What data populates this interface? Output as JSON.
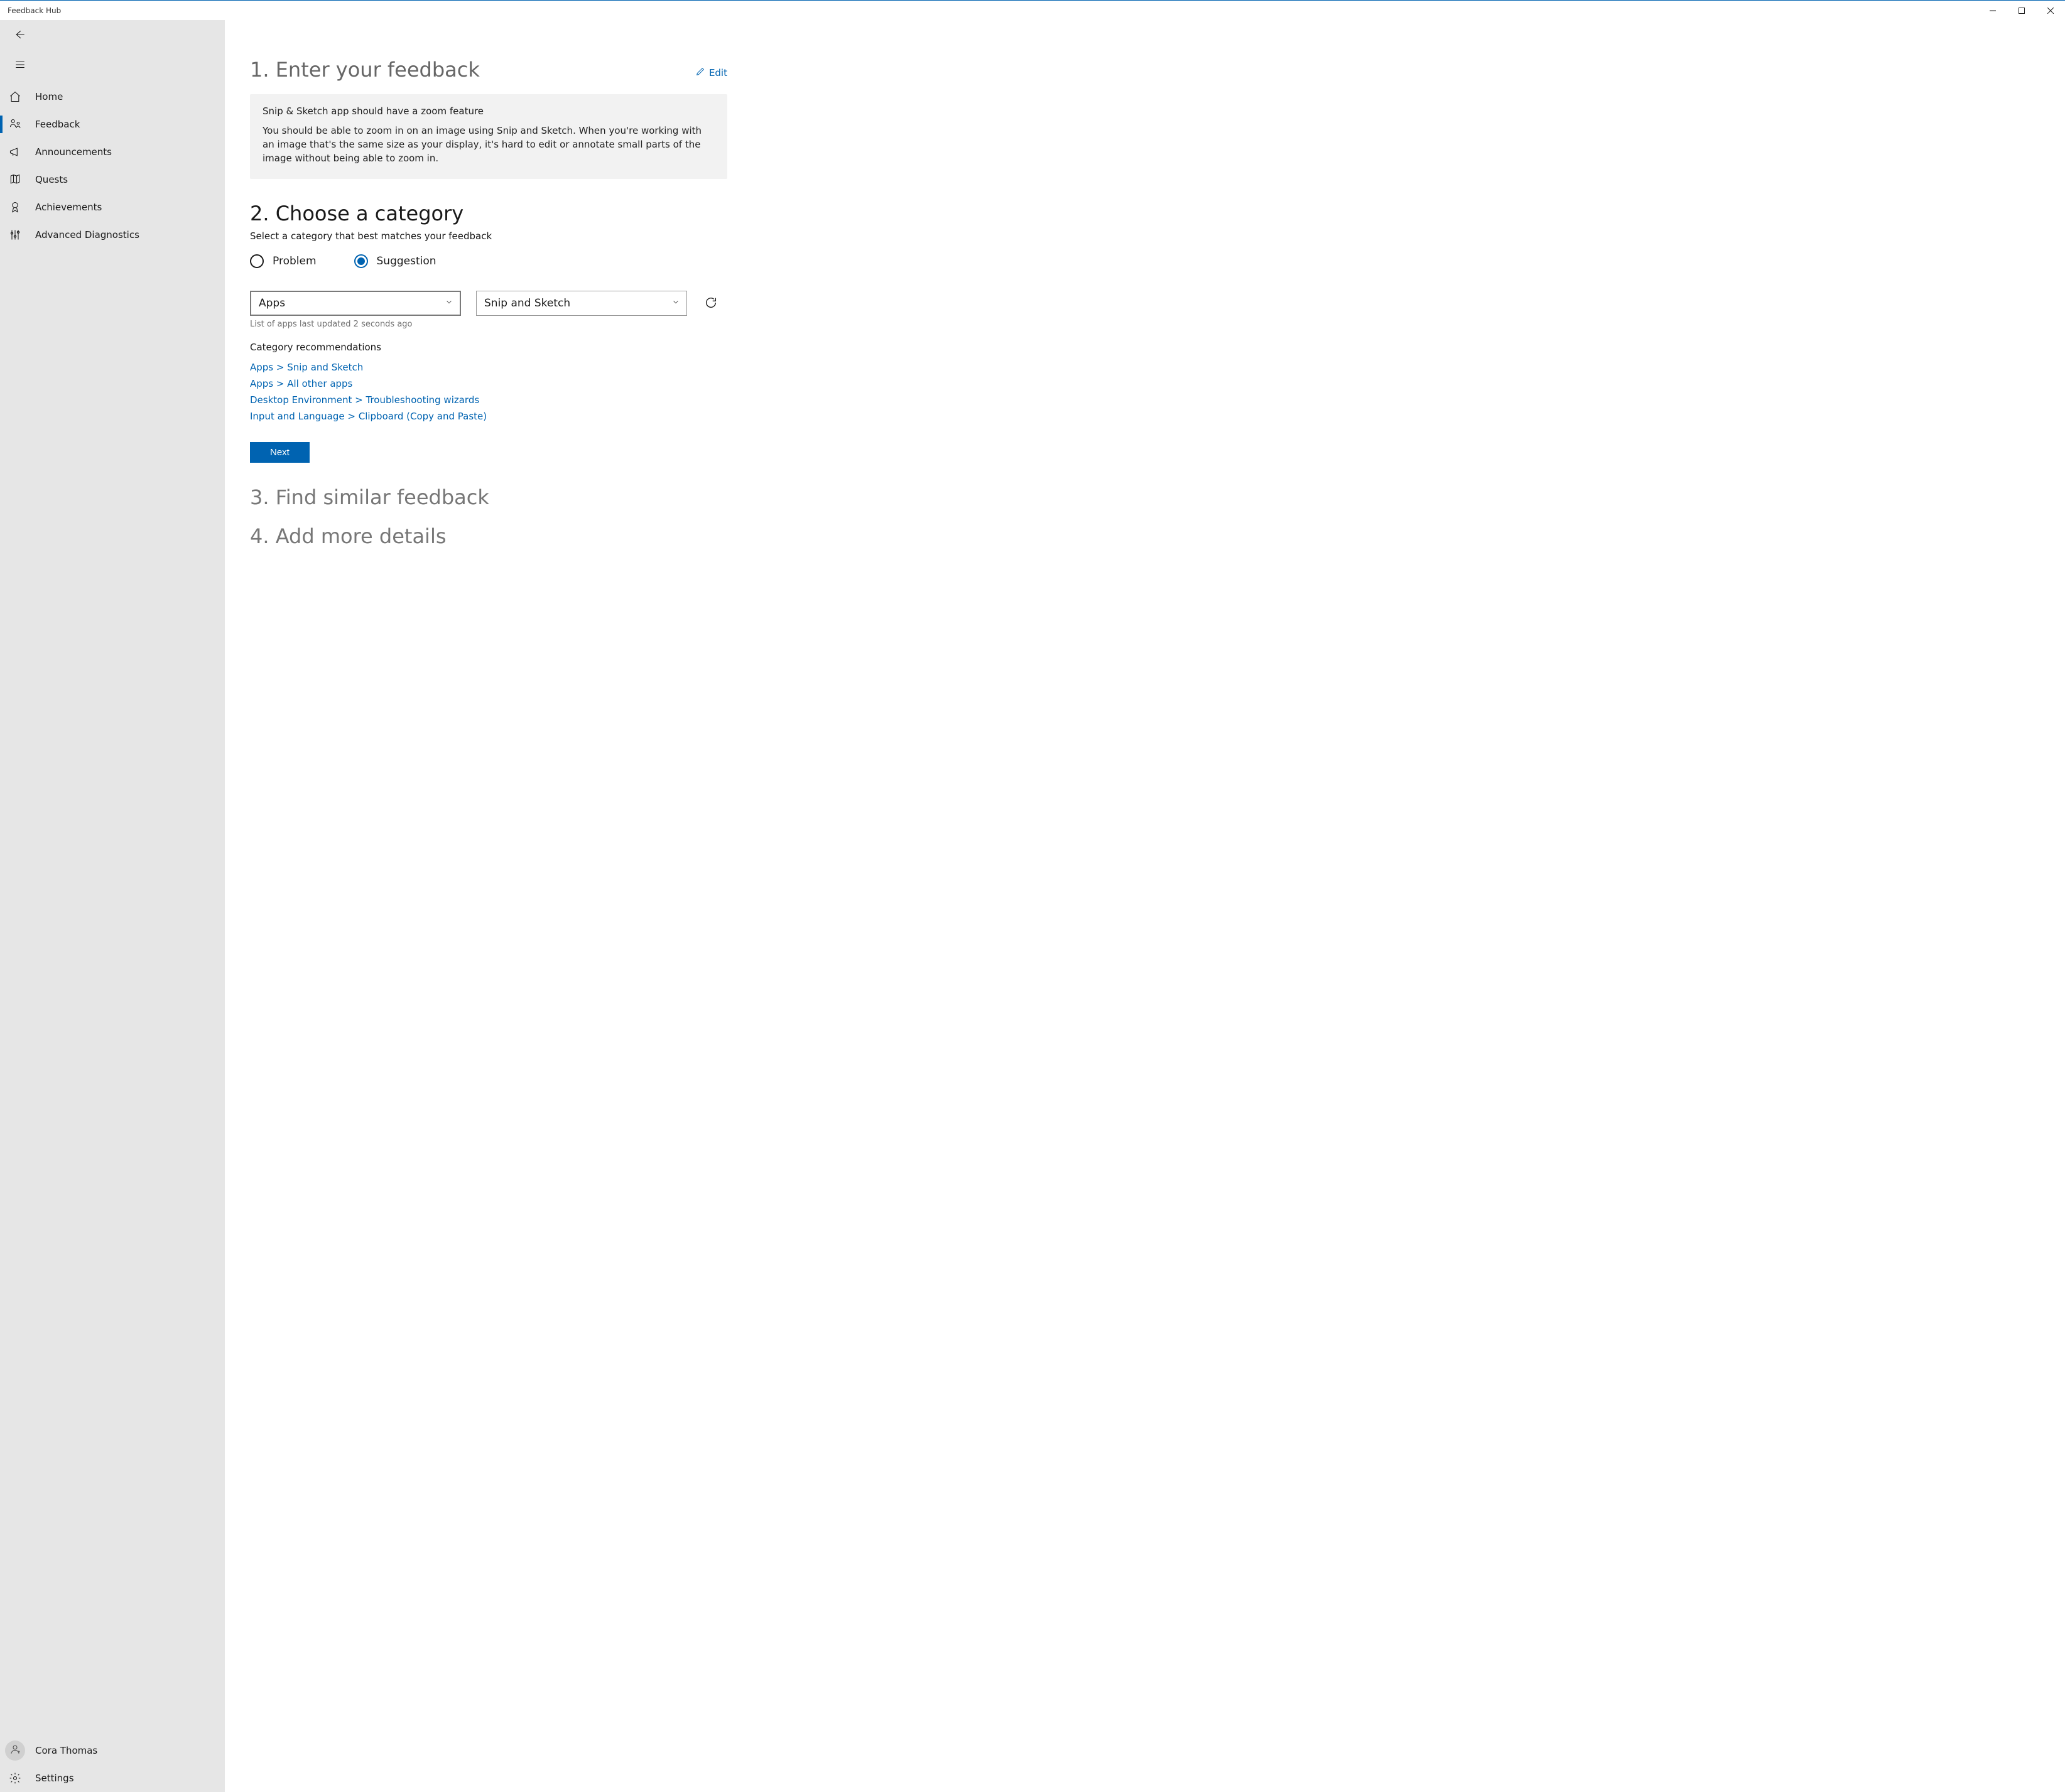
{
  "window": {
    "title": "Feedback Hub"
  },
  "sidebar": {
    "items": [
      {
        "label": "Home"
      },
      {
        "label": "Feedback"
      },
      {
        "label": "Announcements"
      },
      {
        "label": "Quests"
      },
      {
        "label": "Achievements"
      },
      {
        "label": "Advanced Diagnostics"
      }
    ],
    "user": {
      "name": "Cora Thomas"
    },
    "settings_label": "Settings"
  },
  "main": {
    "step1": {
      "title": "1. Enter your feedback",
      "edit_label": "Edit",
      "feedback_title": "Snip & Sketch app should have a zoom feature",
      "feedback_body": "You should be able to zoom in on an image using Snip and Sketch. When you're working with an image that's the same size as your display, it's hard to edit or annotate small parts of the image without being able to zoom in."
    },
    "step2": {
      "title": "2. Choose a category",
      "subhead": "Select a category that best matches your feedback",
      "radios": {
        "problem": "Problem",
        "suggestion": "Suggestion",
        "selected": "suggestion"
      },
      "category_combo": "Apps",
      "subcategory_combo": "Snip and Sketch",
      "update_note": "List of apps last updated 2 seconds ago",
      "recs_title": "Category recommendations",
      "recs": [
        "Apps > Snip and Sketch",
        "Apps > All other apps",
        "Desktop Environment > Troubleshooting wizards",
        "Input and Language > Clipboard (Copy and Paste)"
      ],
      "next_label": "Next"
    },
    "step3": {
      "title": "3. Find similar feedback"
    },
    "step4": {
      "title": "4. Add more details"
    }
  }
}
